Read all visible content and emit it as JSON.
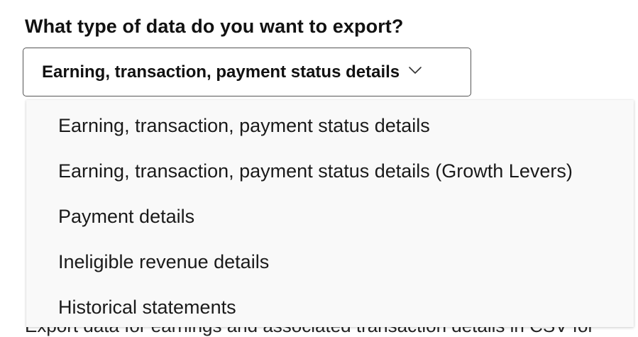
{
  "form": {
    "question": "What type of data do you want to export?",
    "select": {
      "selected_value": "Earning, transaction, payment status details",
      "options": [
        "Earning, transaction, payment status details",
        "Earning, transaction, payment status details (Growth Levers)",
        "Payment details",
        "Ineligible revenue details",
        "Historical statements"
      ]
    },
    "obscured_text": "Export data for earnings and associated transaction details in CSV for"
  },
  "icons": {
    "dropdown_indicator": "chevron-down-icon"
  },
  "colors": {
    "text": "#111111",
    "border": "#555555",
    "menu_background": "#f9f9f9"
  }
}
